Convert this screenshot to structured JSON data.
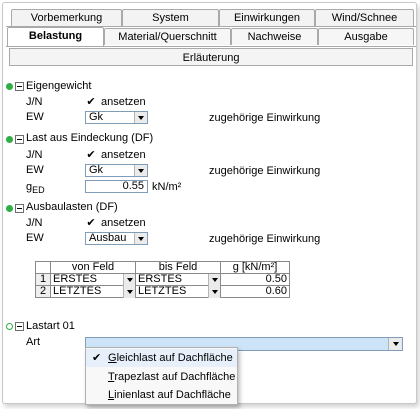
{
  "tabs_row1": [
    "Vorbemerkung",
    "System",
    "Einwirkungen",
    "Wind/Schnee"
  ],
  "tabs_row2": [
    "Belastung",
    "Material/Querschnitt",
    "Nachweise",
    "Ausgabe"
  ],
  "active_tab": "Belastung",
  "subtab": "Erläuterung",
  "groups": {
    "eigengewicht": {
      "title": "Eigengewicht",
      "jn_label": "J/N",
      "check_label": "ansetzen",
      "checked": true,
      "ew_label": "EW",
      "ew_value": "Gk",
      "hint": "zugehörige Einwirkung"
    },
    "dach": {
      "title": "Last aus Eindeckung (DF)",
      "jn_label": "J/N",
      "check_label": "ansetzen",
      "checked": true,
      "ew_label": "EW",
      "ew_value": "Gk",
      "hint": "zugehörige Einwirkung",
      "g_label_main": "g",
      "g_label_sub": "ED",
      "g_value": "0.55",
      "g_unit": "kN/m²"
    },
    "ausbau": {
      "title": "Ausbaulasten (DF)",
      "jn_label": "J/N",
      "check_label": "ansetzen",
      "checked": true,
      "ew_label": "EW",
      "ew_value": "Ausbau",
      "hint": "zugehörige Einwirkung"
    }
  },
  "table": {
    "headers": [
      "von Feld",
      "bis Feld",
      "g [kN/m²]"
    ],
    "rows": [
      {
        "num": "1",
        "von": "ERSTES",
        "bis": "ERSTES",
        "g": "0.50"
      },
      {
        "num": "2",
        "von": "LETZTES",
        "bis": "LETZTES",
        "g": "0.60"
      }
    ]
  },
  "lastart": {
    "title": "Lastart 01",
    "art_label": "Art",
    "art_value": ""
  },
  "menu": {
    "items": [
      {
        "first": "G",
        "rest": "leichlast auf Dachfläche",
        "checked": true
      },
      {
        "first": "T",
        "rest": "rapezlast auf Dachfläche",
        "checked": false
      },
      {
        "first": "L",
        "rest": "inienlast auf Dachfläche",
        "checked": false
      }
    ]
  },
  "colors": {
    "status_green": "#2fae45",
    "selection_blue": "#cde3f7"
  }
}
